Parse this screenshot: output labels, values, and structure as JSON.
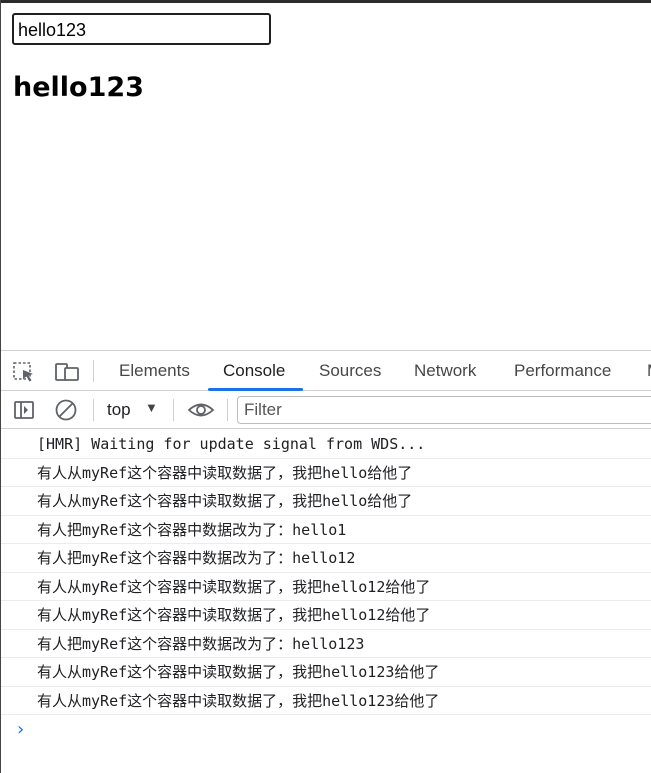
{
  "app": {
    "input_value": "hello123",
    "heading": "hello123"
  },
  "devtools": {
    "tabs": [
      {
        "label": "Elements"
      },
      {
        "label": "Console",
        "active": true
      },
      {
        "label": "Sources"
      },
      {
        "label": "Network"
      },
      {
        "label": "Performance"
      }
    ],
    "overflow_tab_fragment": "M",
    "toolbar": {
      "context": "top",
      "filter_placeholder": "Filter"
    },
    "console_messages": [
      "[HMR] Waiting for update signal from WDS...",
      "有人从myRef这个容器中读取数据了，我把hello给他了",
      "有人从myRef这个容器中读取数据了，我把hello给他了",
      "有人把myRef这个容器中数据改为了：hello1",
      "有人把myRef这个容器中数据改为了：hello12",
      "有人从myRef这个容器中读取数据了，我把hello12给他了",
      "有人从myRef这个容器中读取数据了，我把hello12给他了",
      "有人把myRef这个容器中数据改为了：hello123",
      "有人从myRef这个容器中读取数据了，我把hello123给他了",
      "有人从myRef这个容器中读取数据了，我把hello123给他了"
    ],
    "icons": {
      "inspect": "inspect-element-icon",
      "device": "device-toolbar-icon",
      "sidebar": "show-sidebar-icon",
      "clear": "clear-console-icon",
      "eye": "live-expression-icon",
      "prompt": "console-prompt-icon"
    },
    "accent_color": "#1a73e8"
  }
}
